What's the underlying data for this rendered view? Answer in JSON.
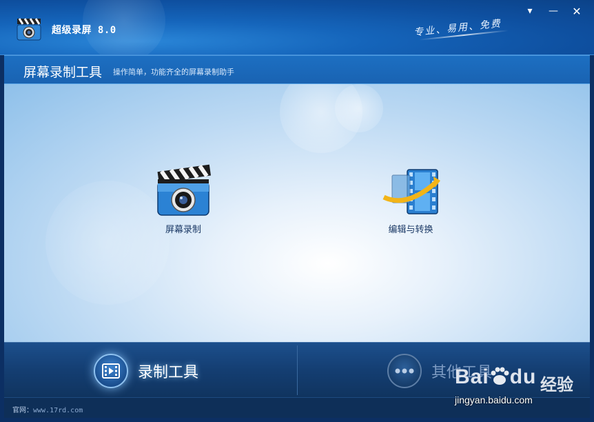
{
  "app": {
    "title": "超级录屏 8.0",
    "slogan": "专业、易用、免费"
  },
  "window_controls": {
    "menu": "▾",
    "minimize": "—",
    "close": "✕"
  },
  "band": {
    "title": "屏幕录制工具",
    "subtitle": "操作简单，功能齐全的屏幕录制助手"
  },
  "tools": [
    {
      "label": "屏幕录制",
      "icon": "clapperboard-camera-icon"
    },
    {
      "label": "编辑与转换",
      "icon": "film-convert-icon"
    }
  ],
  "bottom_nav": [
    {
      "label": "录制工具",
      "icon": "film-icon",
      "active": true
    },
    {
      "label": "其他工具",
      "icon": "more-dots-icon",
      "active": false
    }
  ],
  "footer": {
    "label": "官网：",
    "url": "www.17rd.com"
  },
  "watermark": {
    "brand": "Bai",
    "brand2": "du",
    "cn": "经验",
    "url": "jingyan.baidu.com"
  },
  "colors": {
    "accent": "#1565bb",
    "band": "#1a63b2",
    "bottom": "#143e72",
    "footer": "#0e2f58"
  }
}
